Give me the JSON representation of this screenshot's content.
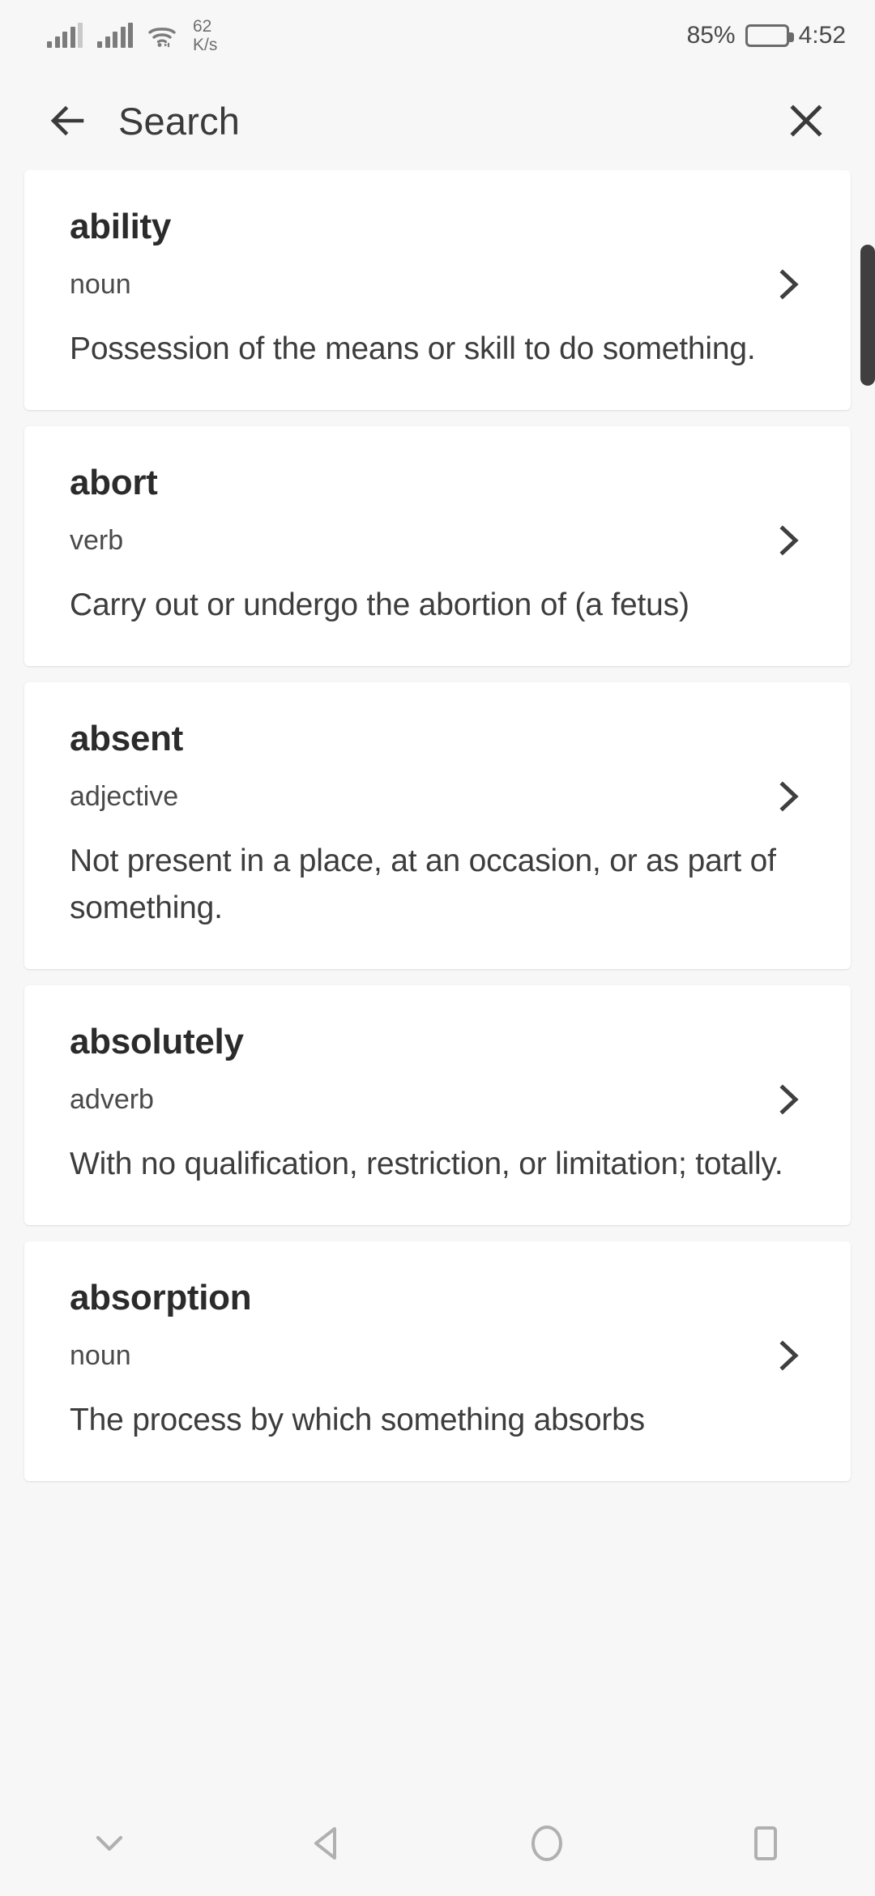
{
  "status_bar": {
    "network_speed": "62",
    "network_speed_unit": "K/s",
    "battery_percent": "85%",
    "time": "4:52",
    "icons": {
      "signal1": "signal-bars-icon",
      "signal2": "signal-bars-icon",
      "wifi": "wifi-icon",
      "battery": "battery-icon"
    }
  },
  "header": {
    "title": "Search",
    "back_icon": "back-arrow-icon",
    "close_icon": "close-icon"
  },
  "results": [
    {
      "word": "ability",
      "part_of_speech": "noun",
      "definition": "Possession of the means or skill to do something."
    },
    {
      "word": "abort",
      "part_of_speech": "verb",
      "definition": "Carry out or undergo the abortion of (a fetus)"
    },
    {
      "word": "absent",
      "part_of_speech": "adjective",
      "definition": "Not present in a place, at an occasion, or as part of something."
    },
    {
      "word": "absolutely",
      "part_of_speech": "adverb",
      "definition": "With no qualification, restriction, or limitation; totally."
    },
    {
      "word": "absorption",
      "part_of_speech": "noun",
      "definition": "The process by which something absorbs"
    }
  ],
  "nav_bar": {
    "items": [
      {
        "icon": "chevron-down-icon"
      },
      {
        "icon": "back-triangle-icon"
      },
      {
        "icon": "home-circle-icon"
      },
      {
        "icon": "recents-square-icon"
      }
    ]
  },
  "colors": {
    "background": "#f7f7f7",
    "card": "#ffffff",
    "text_primary": "#2b2b2b",
    "text_secondary": "#4a4a4a",
    "scrollbar": "#3f3f3f"
  }
}
